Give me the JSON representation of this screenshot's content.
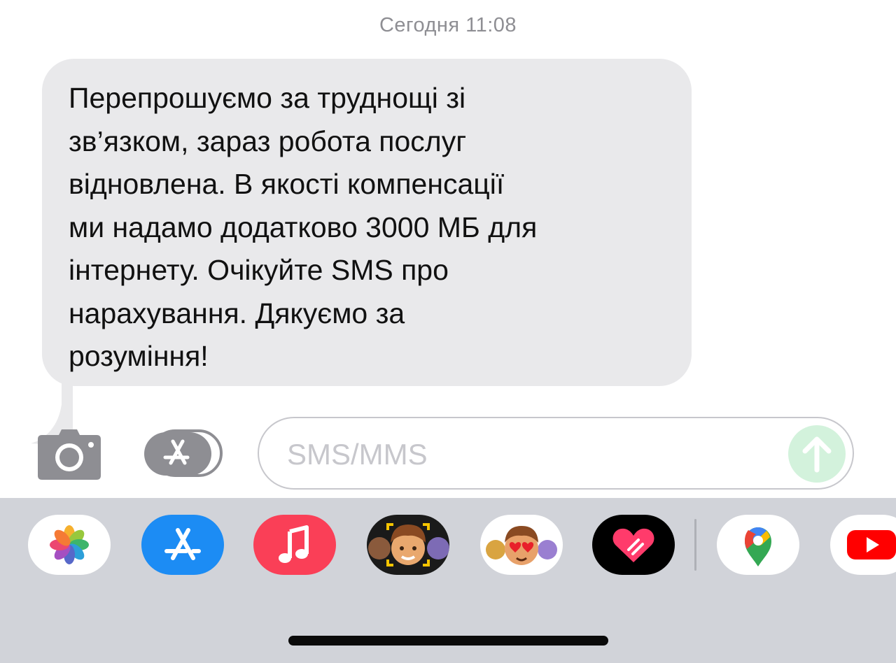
{
  "timestamp": "Сегодня 11:08",
  "message": {
    "lines": [
      "Перепрошуємо за труднощі зі",
      "зв’язком, зараз робота послуг",
      "відновлена. В якості компенсації",
      "ми надамо додатково 3000 МБ для",
      "інтернету. Очікуйте SMS про",
      "нарахування. Дякуємо за",
      "розуміння!"
    ]
  },
  "composer": {
    "placeholder": "SMS/MMS"
  },
  "app_drawer": {
    "apps": [
      {
        "icon": "photos-icon"
      },
      {
        "icon": "app-store-icon"
      },
      {
        "icon": "music-icon"
      },
      {
        "icon": "memoji-icon"
      },
      {
        "icon": "memoji-stickers-icon"
      },
      {
        "icon": "digital-touch-icon"
      },
      {
        "icon": "google-maps-icon"
      },
      {
        "icon": "youtube-icon"
      }
    ]
  },
  "colors": {
    "bubble": "#e9e9eb",
    "drawer": "#d1d3d9",
    "send_button": "#d3f2dc",
    "app_store_blue": "#1c8cf4",
    "music_red": "#fa3f57"
  }
}
